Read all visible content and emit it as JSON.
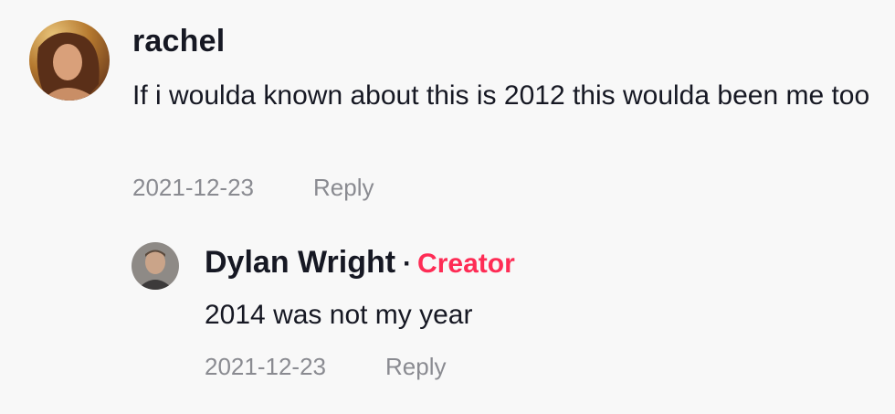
{
  "comments": [
    {
      "username": "rachel",
      "text": "If i woulda known about this is 2012 this woulda been me too",
      "date": "2021-12-23",
      "reply_label": "Reply",
      "avatar_icon": "user-photo-avatar"
    }
  ],
  "replies": [
    {
      "username": "Dylan Wright",
      "separator": "·",
      "badge": "Creator",
      "text": "2014 was not my year",
      "date": "2021-12-23",
      "reply_label": "Reply",
      "avatar_icon": "user-photo-avatar"
    }
  ],
  "colors": {
    "background": "#f8f8f8",
    "text": "#161823",
    "muted": "#8a8b91",
    "creator_badge": "#fe2c55"
  }
}
